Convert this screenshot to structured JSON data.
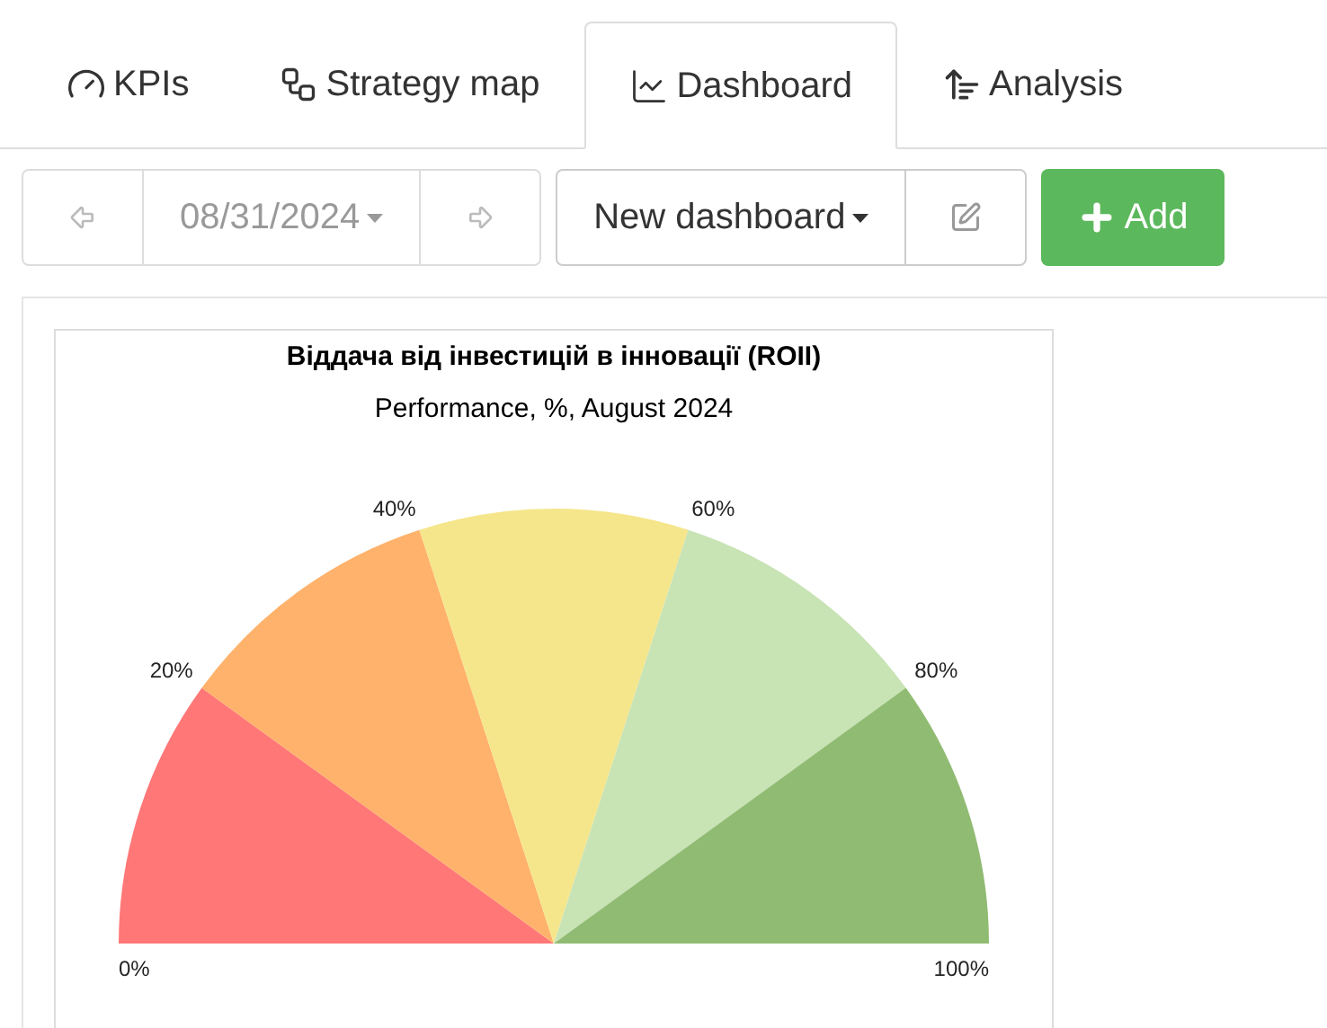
{
  "tabs": [
    {
      "label": "KPIs",
      "kind": "gauge",
      "selected": false
    },
    {
      "label": "Strategy map",
      "kind": "map",
      "selected": false
    },
    {
      "label": "Dashboard",
      "kind": "chart",
      "selected": true
    },
    {
      "label": "Analysis",
      "kind": "sort",
      "selected": false
    }
  ],
  "toolbar": {
    "date": "08/31/2024",
    "dashboard": "New dashboard",
    "add_button": "Add"
  },
  "widget": {
    "title": "Віддача від інвестицій в інновації (ROII)",
    "subtitle": "Performance, %, August 2024",
    "scale_labels": [
      "0%",
      "20%",
      "40%",
      "60%",
      "80%",
      "100%"
    ],
    "bands": [
      {
        "color": "#ff7777"
      },
      {
        "color": "#ffb26b"
      },
      {
        "color": "#f5e68c"
      },
      {
        "color": "#c8e3b4"
      },
      {
        "color": "#90bb72"
      }
    ]
  }
}
